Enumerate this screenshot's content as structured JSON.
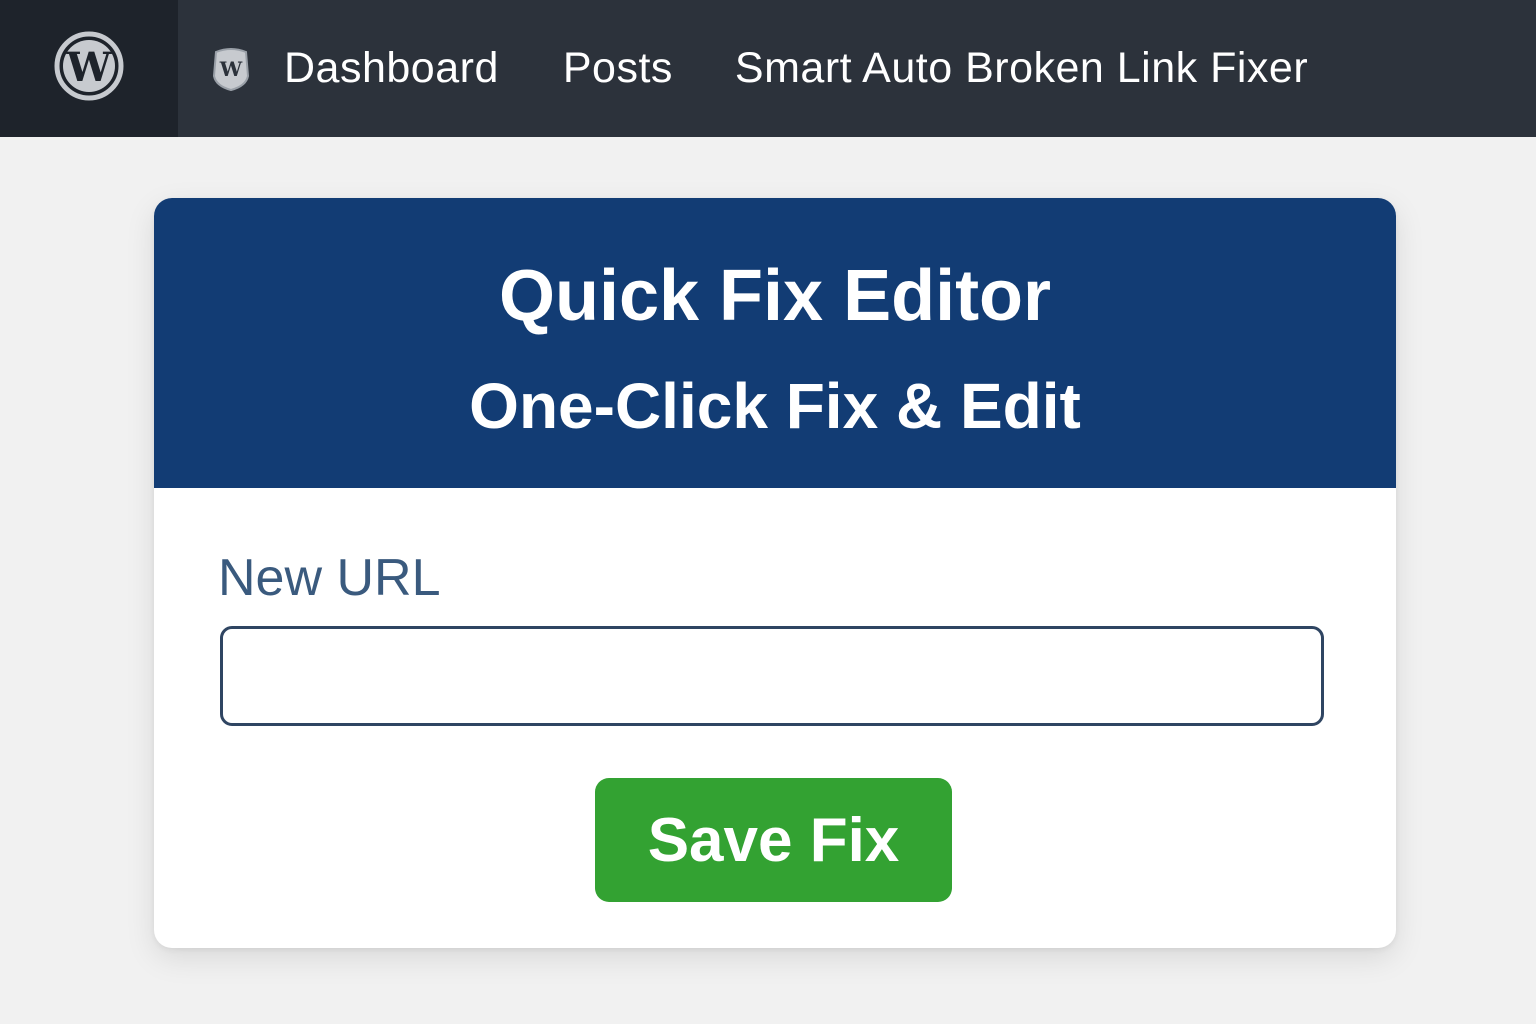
{
  "adminbar": {
    "logo_icon": "wordpress-logo-icon",
    "plugin_icon": "plugin-badge-icon",
    "items": [
      {
        "label": "Dashboard"
      },
      {
        "label": "Posts"
      },
      {
        "label": "Smart Auto Broken Link Fixer"
      }
    ]
  },
  "editor": {
    "title": "Quick Fix Editor",
    "subtitle": "One-Click Fix & Edit",
    "field_label": "New URL",
    "field_value": "",
    "save_label": "Save Fix"
  },
  "colors": {
    "adminbar_bg": "#2c323b",
    "header_bg": "#123c74",
    "save_button_bg": "#33a232",
    "label_color": "#3a5a7e"
  }
}
